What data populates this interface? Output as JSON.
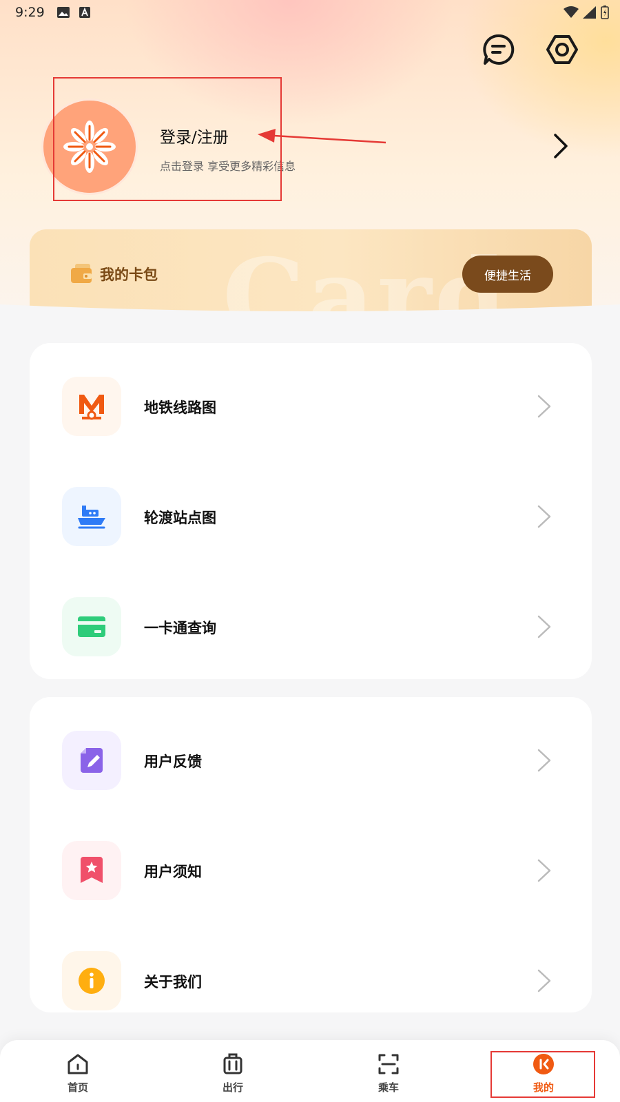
{
  "status_bar": {
    "time": "9:29"
  },
  "profile": {
    "login_title": "登录/注册",
    "login_subtitle": "点击登录 享受更多精彩信息"
  },
  "wallet": {
    "label": "我的卡包",
    "background_text": "Card",
    "button_label": "便捷生活"
  },
  "menu_group_1": [
    {
      "label": "地铁线路图",
      "icon": "metro-icon"
    },
    {
      "label": "轮渡站点图",
      "icon": "ferry-icon"
    },
    {
      "label": "一卡通查询",
      "icon": "card-icon"
    }
  ],
  "menu_group_2": [
    {
      "label": "用户反馈",
      "icon": "feedback-icon"
    },
    {
      "label": "用户须知",
      "icon": "notice-icon"
    },
    {
      "label": "关于我们",
      "icon": "info-icon"
    }
  ],
  "tabbar": [
    {
      "label": "首页",
      "icon": "home-icon"
    },
    {
      "label": "出行",
      "icon": "luggage-icon"
    },
    {
      "label": "乘车",
      "icon": "scan-icon"
    },
    {
      "label": "我的",
      "icon": "profile-icon",
      "active": true
    }
  ],
  "colors": {
    "accent": "#f05a12",
    "wallet_button": "#7a4a1c",
    "annotation": "#e53935"
  }
}
